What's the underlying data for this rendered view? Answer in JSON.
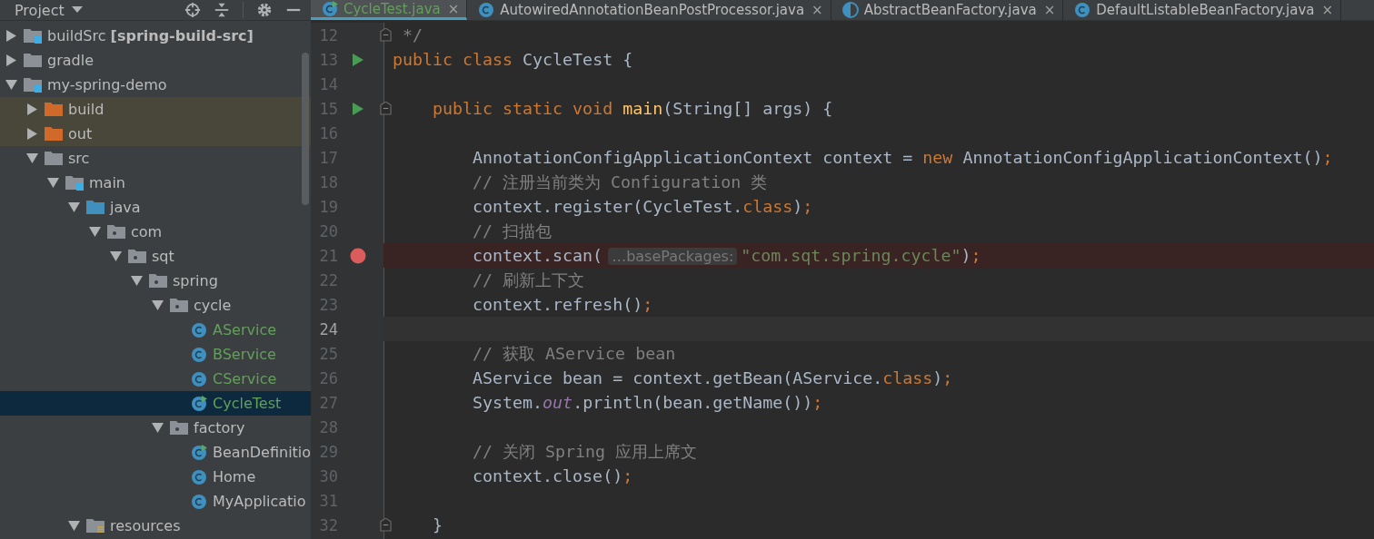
{
  "project_panel": {
    "title": "Project",
    "tree": [
      {
        "label": "buildSrc **[spring-build-src]**",
        "kind": "module",
        "expanded": false,
        "selected": false,
        "excluded": false
      },
      {
        "label": "gradle",
        "kind": "folder",
        "expanded": false,
        "selected": false,
        "excluded": false
      },
      {
        "label": "my-spring-demo",
        "kind": "module",
        "expanded": true,
        "selected": false,
        "excluded": false,
        "children": [
          {
            "label": "build",
            "kind": "excluded-folder",
            "expanded": false,
            "selected": false,
            "excluded": true
          },
          {
            "label": "out",
            "kind": "excluded-folder",
            "expanded": false,
            "selected": false,
            "excluded": true
          },
          {
            "label": "src",
            "kind": "folder",
            "expanded": true,
            "selected": false,
            "excluded": false,
            "children": [
              {
                "label": "main",
                "kind": "module",
                "expanded": true,
                "selected": false,
                "excluded": false,
                "children": [
                  {
                    "label": "java",
                    "kind": "source-folder",
                    "expanded": true,
                    "selected": false,
                    "excluded": false,
                    "children": [
                      {
                        "label": "com",
                        "kind": "package",
                        "expanded": true,
                        "selected": false,
                        "excluded": false,
                        "children": [
                          {
                            "label": "sqt",
                            "kind": "package",
                            "expanded": true,
                            "selected": false,
                            "excluded": false,
                            "children": [
                              {
                                "label": "spring",
                                "kind": "package",
                                "expanded": true,
                                "selected": false,
                                "excluded": false,
                                "children": [
                                  {
                                    "label": "cycle",
                                    "kind": "package",
                                    "expanded": true,
                                    "selected": false,
                                    "excluded": false,
                                    "children": [
                                      {
                                        "label": "AService",
                                        "kind": "class",
                                        "new_file": true,
                                        "selected": false,
                                        "excluded": false
                                      },
                                      {
                                        "label": "BService",
                                        "kind": "class",
                                        "new_file": true,
                                        "selected": false,
                                        "excluded": false
                                      },
                                      {
                                        "label": "CService",
                                        "kind": "class",
                                        "new_file": true,
                                        "selected": false,
                                        "excluded": false
                                      },
                                      {
                                        "label": "CycleTest",
                                        "kind": "class-main",
                                        "new_file": true,
                                        "selected": true,
                                        "excluded": false
                                      }
                                    ]
                                  },
                                  {
                                    "label": "factory",
                                    "kind": "package",
                                    "expanded": true,
                                    "selected": false,
                                    "excluded": false,
                                    "children": [
                                      {
                                        "label": "BeanDefinitio",
                                        "kind": "class-main",
                                        "new_file": false,
                                        "selected": false,
                                        "excluded": false
                                      },
                                      {
                                        "label": "Home",
                                        "kind": "class",
                                        "new_file": false,
                                        "selected": false,
                                        "excluded": false
                                      },
                                      {
                                        "label": "MyApplicatio",
                                        "kind": "class",
                                        "new_file": false,
                                        "selected": false,
                                        "excluded": false
                                      }
                                    ]
                                  }
                                ]
                              }
                            ]
                          }
                        ]
                      }
                    ]
                  },
                  {
                    "label": "resources",
                    "kind": "resources-folder",
                    "expanded": true,
                    "selected": false,
                    "excluded": false
                  }
                ]
              }
            ]
          }
        ]
      }
    ]
  },
  "tabs": [
    {
      "label": "CycleTest.java",
      "kind": "class-main",
      "selected": true,
      "close": "×"
    },
    {
      "label": "AutowiredAnnotationBeanPostProcessor.java",
      "kind": "class",
      "selected": false,
      "close": "×"
    },
    {
      "label": "AbstractBeanFactory.java",
      "kind": "abstract",
      "selected": false,
      "close": "×"
    },
    {
      "label": "DefaultListableBeanFactory.java",
      "kind": "class",
      "selected": false,
      "close": "×"
    }
  ],
  "editor": {
    "lines": [
      {
        "number": "12",
        "run": false,
        "breakpoint": false,
        "current": false,
        "fold": true,
        "tokens": [
          {
            "kind": "comment",
            "text": " */"
          }
        ]
      },
      {
        "number": "13",
        "run": true,
        "breakpoint": false,
        "current": false,
        "fold": false,
        "tokens": [
          {
            "kind": "keyword",
            "text": "public class"
          },
          {
            "kind": "plain",
            "text": " CycleTest {"
          }
        ]
      },
      {
        "number": "14",
        "run": false,
        "breakpoint": false,
        "current": false,
        "fold": false
      },
      {
        "number": "15",
        "run": true,
        "breakpoint": false,
        "current": false,
        "fold": true,
        "tokens": [
          {
            "kind": "keyword",
            "text": "    public static void"
          },
          {
            "kind": "method",
            "text": " main"
          },
          {
            "kind": "plain",
            "text": "(String[] args) {"
          }
        ]
      },
      {
        "number": "16",
        "run": false,
        "breakpoint": false,
        "current": false,
        "fold": false
      },
      {
        "number": "17",
        "run": false,
        "breakpoint": false,
        "current": false,
        "fold": false,
        "tokens": [
          {
            "kind": "plain",
            "text": "        AnnotationConfigApplicationContext context = "
          },
          {
            "kind": "keyword",
            "text": "new"
          },
          {
            "kind": "plain",
            "text": " AnnotationConfigApplicationContext()"
          },
          {
            "kind": "keyword",
            "text": ";"
          }
        ]
      },
      {
        "number": "18",
        "run": false,
        "breakpoint": false,
        "current": false,
        "fold": false,
        "tokens": [
          {
            "kind": "comment",
            "text": "        // 注册当前类为 Configuration 类"
          }
        ]
      },
      {
        "number": "19",
        "run": false,
        "breakpoint": false,
        "current": false,
        "fold": false,
        "tokens": [
          {
            "kind": "plain",
            "text": "        context.register(CycleTest."
          },
          {
            "kind": "keyword",
            "text": "class"
          },
          {
            "kind": "plain",
            "text": ")"
          },
          {
            "kind": "keyword",
            "text": ";"
          }
        ]
      },
      {
        "number": "20",
        "run": false,
        "breakpoint": false,
        "current": false,
        "fold": false,
        "tokens": [
          {
            "kind": "comment",
            "text": "        // 扫描包"
          }
        ]
      },
      {
        "number": "21",
        "run": false,
        "breakpoint": true,
        "current": false,
        "fold": false,
        "tokens": [
          {
            "kind": "plain",
            "text": "        context.scan("
          },
          {
            "kind": "hint",
            "text": "…basePackages:"
          },
          {
            "kind": "string",
            "text": "\"com.sqt.spring.cycle\""
          },
          {
            "kind": "plain",
            "text": ")"
          },
          {
            "kind": "keyword",
            "text": ";"
          }
        ]
      },
      {
        "number": "22",
        "run": false,
        "breakpoint": false,
        "current": false,
        "fold": false,
        "tokens": [
          {
            "kind": "comment",
            "text": "        // 刷新上下文"
          }
        ]
      },
      {
        "number": "23",
        "run": false,
        "breakpoint": false,
        "current": false,
        "fold": false,
        "tokens": [
          {
            "kind": "plain",
            "text": "        context.refresh()"
          },
          {
            "kind": "keyword",
            "text": ";"
          }
        ]
      },
      {
        "number": "24",
        "run": false,
        "breakpoint": false,
        "current": true,
        "fold": false
      },
      {
        "number": "25",
        "run": false,
        "breakpoint": false,
        "current": false,
        "fold": false,
        "tokens": [
          {
            "kind": "comment",
            "text": "        // 获取 AService bean"
          }
        ]
      },
      {
        "number": "26",
        "run": false,
        "breakpoint": false,
        "current": false,
        "fold": false,
        "tokens": [
          {
            "kind": "plain",
            "text": "        AService bean = context.getBean(AService."
          },
          {
            "kind": "keyword",
            "text": "class"
          },
          {
            "kind": "plain",
            "text": ")"
          },
          {
            "kind": "keyword",
            "text": ";"
          }
        ]
      },
      {
        "number": "27",
        "run": false,
        "breakpoint": false,
        "current": false,
        "fold": false,
        "tokens": [
          {
            "kind": "plain",
            "text": "        System."
          },
          {
            "kind": "static-field",
            "text": "out"
          },
          {
            "kind": "plain",
            "text": ".println(bean.getName())"
          },
          {
            "kind": "keyword",
            "text": ";"
          }
        ]
      },
      {
        "number": "28",
        "run": false,
        "breakpoint": false,
        "current": false,
        "fold": false
      },
      {
        "number": "29",
        "run": false,
        "breakpoint": false,
        "current": false,
        "fold": false,
        "tokens": [
          {
            "kind": "comment",
            "text": "        // 关闭 Spring 应用上席文"
          }
        ]
      },
      {
        "number": "30",
        "run": false,
        "breakpoint": false,
        "current": false,
        "fold": false,
        "tokens": [
          {
            "kind": "plain",
            "text": "        context.close()"
          },
          {
            "kind": "keyword",
            "text": ";"
          }
        ]
      },
      {
        "number": "31",
        "run": false,
        "breakpoint": false,
        "current": false,
        "fold": false
      },
      {
        "number": "32",
        "run": false,
        "breakpoint": false,
        "current": false,
        "fold": true,
        "tokens": [
          {
            "kind": "plain",
            "text": "    }"
          }
        ]
      }
    ]
  }
}
